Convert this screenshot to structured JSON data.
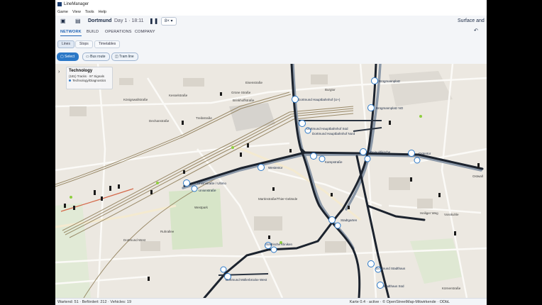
{
  "window": {
    "title": "LineManager"
  },
  "menu": [
    "Game",
    "View",
    "Tools",
    "Help"
  ],
  "topbar": {
    "city": "Dortmund",
    "day_time": "Day 1 · 18:11",
    "speed": "8×",
    "right_text": "Surface and"
  },
  "tabs": [
    {
      "label": "NETWORK",
      "active": true
    },
    {
      "label": "BUILD",
      "active": false
    },
    {
      "label": "OPERATIONS",
      "active": false
    },
    {
      "label": "COMPANY",
      "active": false
    }
  ],
  "subtabs": [
    {
      "label": "Lines",
      "active": true
    },
    {
      "label": "Stops",
      "active": false
    },
    {
      "label": "Timetables",
      "active": false
    }
  ],
  "tools": {
    "select": "Select",
    "bus_route": "Bus route",
    "tram_line": "Tram line"
  },
  "panel": {
    "title": "Technology",
    "line1": "(181) Tracks · 97 Signals",
    "line2": "Technology/Diagnostics"
  },
  "map_labels": {
    "streets": [
      "Kesselstraße",
      "Königswallstraße",
      "Dechanstraße",
      "Grüne Straße",
      "Brinkhoffstraße",
      "Eisenstraße",
      "Treibstraße",
      "Burgtor",
      "Martinstraße/Thier-Gelände",
      "Westpark",
      "Ruhrallee",
      "Vosskuhle",
      "Heiliger Weg",
      "Dortmund West",
      "Körnerstraße",
      "Ostwall"
    ],
    "stations": [
      "Dortmund Hauptbahnhof (U+)",
      "Dortmund Hauptbahnhof Süd",
      "Dortmund Hauptbahnhof Nord",
      "Brügmannplatz",
      "Brügmannplatz NO",
      "Westentor",
      "Unionstraße / Ultimo",
      "Unionstraße",
      "Reinoldikirche",
      "Kampstraße",
      "Ostentor",
      "Stadtgarten",
      "Städtische Kliniken",
      "Dortmund Möllerbrücke West",
      "Dortmund Stadthaus",
      "Stadthaus Süd"
    ]
  },
  "status": {
    "left": "Wartend: 51 · Befördert: 212 · Vehicles: 19",
    "right": "Karte 0.4 · active · © OpenStreetMap-Mitwirkende · ODbL"
  },
  "colors": {
    "accent": "#2b78c7",
    "track_dark": "#1c232e",
    "track_light": "#8b98a8",
    "rail": "#8c7a55",
    "park": "#d7e5c8",
    "map_bg": "#ece8e1"
  },
  "icons": {
    "sidebar": "sidebar-icon",
    "calendar": "calendar-icon",
    "pause": "pause-icon",
    "undo": "undo-icon",
    "expand": "chevron-right-icon"
  }
}
